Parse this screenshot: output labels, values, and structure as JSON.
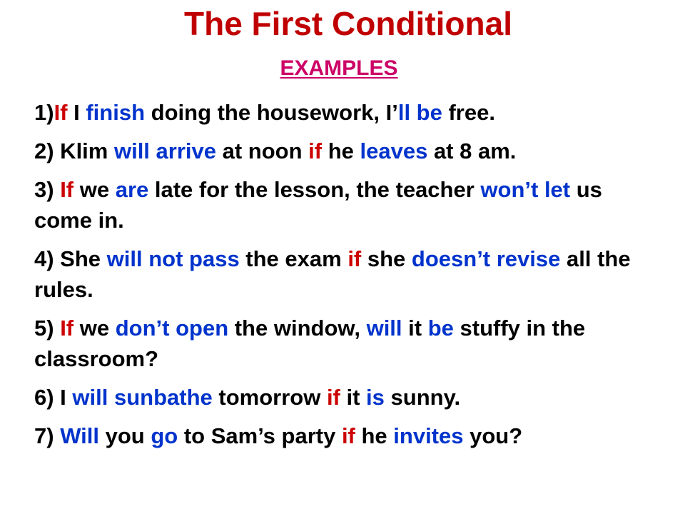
{
  "title": "The First Conditional",
  "subtitle": "EXAMPLES",
  "colors": {
    "title": "#c00000",
    "subtitle": "#cc0066",
    "if": "#cc0000",
    "verb": "#0033cc",
    "text": "#000000"
  },
  "examples": [
    [
      {
        "t": "1)",
        "c": "k"
      },
      {
        "t": "If",
        "c": "r"
      },
      {
        "t": " I ",
        "c": "k"
      },
      {
        "t": "finish",
        "c": "b"
      },
      {
        "t": " doing the housework, I’",
        "c": "k"
      },
      {
        "t": "ll be",
        "c": "b"
      },
      {
        "t": " free.",
        "c": "k"
      }
    ],
    [
      {
        "t": "2) Klim ",
        "c": "k"
      },
      {
        "t": "will arrive",
        "c": "b"
      },
      {
        "t": " at noon ",
        "c": "k"
      },
      {
        "t": "if",
        "c": "r"
      },
      {
        "t": " he ",
        "c": "k"
      },
      {
        "t": "leaves",
        "c": "b"
      },
      {
        "t": " at 8 am.",
        "c": "k"
      }
    ],
    [
      {
        "t": "3) ",
        "c": "k"
      },
      {
        "t": "If",
        "c": "r"
      },
      {
        "t": " we ",
        "c": "k"
      },
      {
        "t": "are",
        "c": "b"
      },
      {
        "t": " late for the lesson, the teacher ",
        "c": "k"
      },
      {
        "t": "won’t let",
        "c": "b"
      },
      {
        "t": " us come in.",
        "c": "k"
      }
    ],
    [
      {
        "t": "4) She ",
        "c": "k"
      },
      {
        "t": "will not pass",
        "c": "b"
      },
      {
        "t": " the exam ",
        "c": "k"
      },
      {
        "t": "if",
        "c": "r"
      },
      {
        "t": " she ",
        "c": "k"
      },
      {
        "t": "doesn’t revise",
        "c": "b"
      },
      {
        "t": " all the rules.",
        "c": "k"
      }
    ],
    [
      {
        "t": "5) ",
        "c": "k"
      },
      {
        "t": "If",
        "c": "r"
      },
      {
        "t": " we ",
        "c": "k"
      },
      {
        "t": "don’t open",
        "c": "b"
      },
      {
        "t": " the window, ",
        "c": "k"
      },
      {
        "t": "will",
        "c": "b"
      },
      {
        "t": " it ",
        "c": "k"
      },
      {
        "t": "be",
        "c": "b"
      },
      {
        "t": " stuffy in the classroom?",
        "c": "k"
      }
    ],
    [
      {
        "t": "6) I ",
        "c": "k"
      },
      {
        "t": "will sunbathe",
        "c": "b"
      },
      {
        "t": " tomorrow ",
        "c": "k"
      },
      {
        "t": "if",
        "c": "r"
      },
      {
        "t": " it ",
        "c": "k"
      },
      {
        "t": "is",
        "c": "b"
      },
      {
        "t": " sunny.",
        "c": "k"
      }
    ],
    [
      {
        "t": "7) ",
        "c": "k"
      },
      {
        "t": "Will",
        "c": "b"
      },
      {
        "t": " you ",
        "c": "k"
      },
      {
        "t": "go",
        "c": "b"
      },
      {
        "t": " to Sam’s party ",
        "c": "k"
      },
      {
        "t": "if",
        "c": "r"
      },
      {
        "t": " he ",
        "c": "k"
      },
      {
        "t": "invites",
        "c": "b"
      },
      {
        "t": " you?",
        "c": "k"
      }
    ]
  ]
}
